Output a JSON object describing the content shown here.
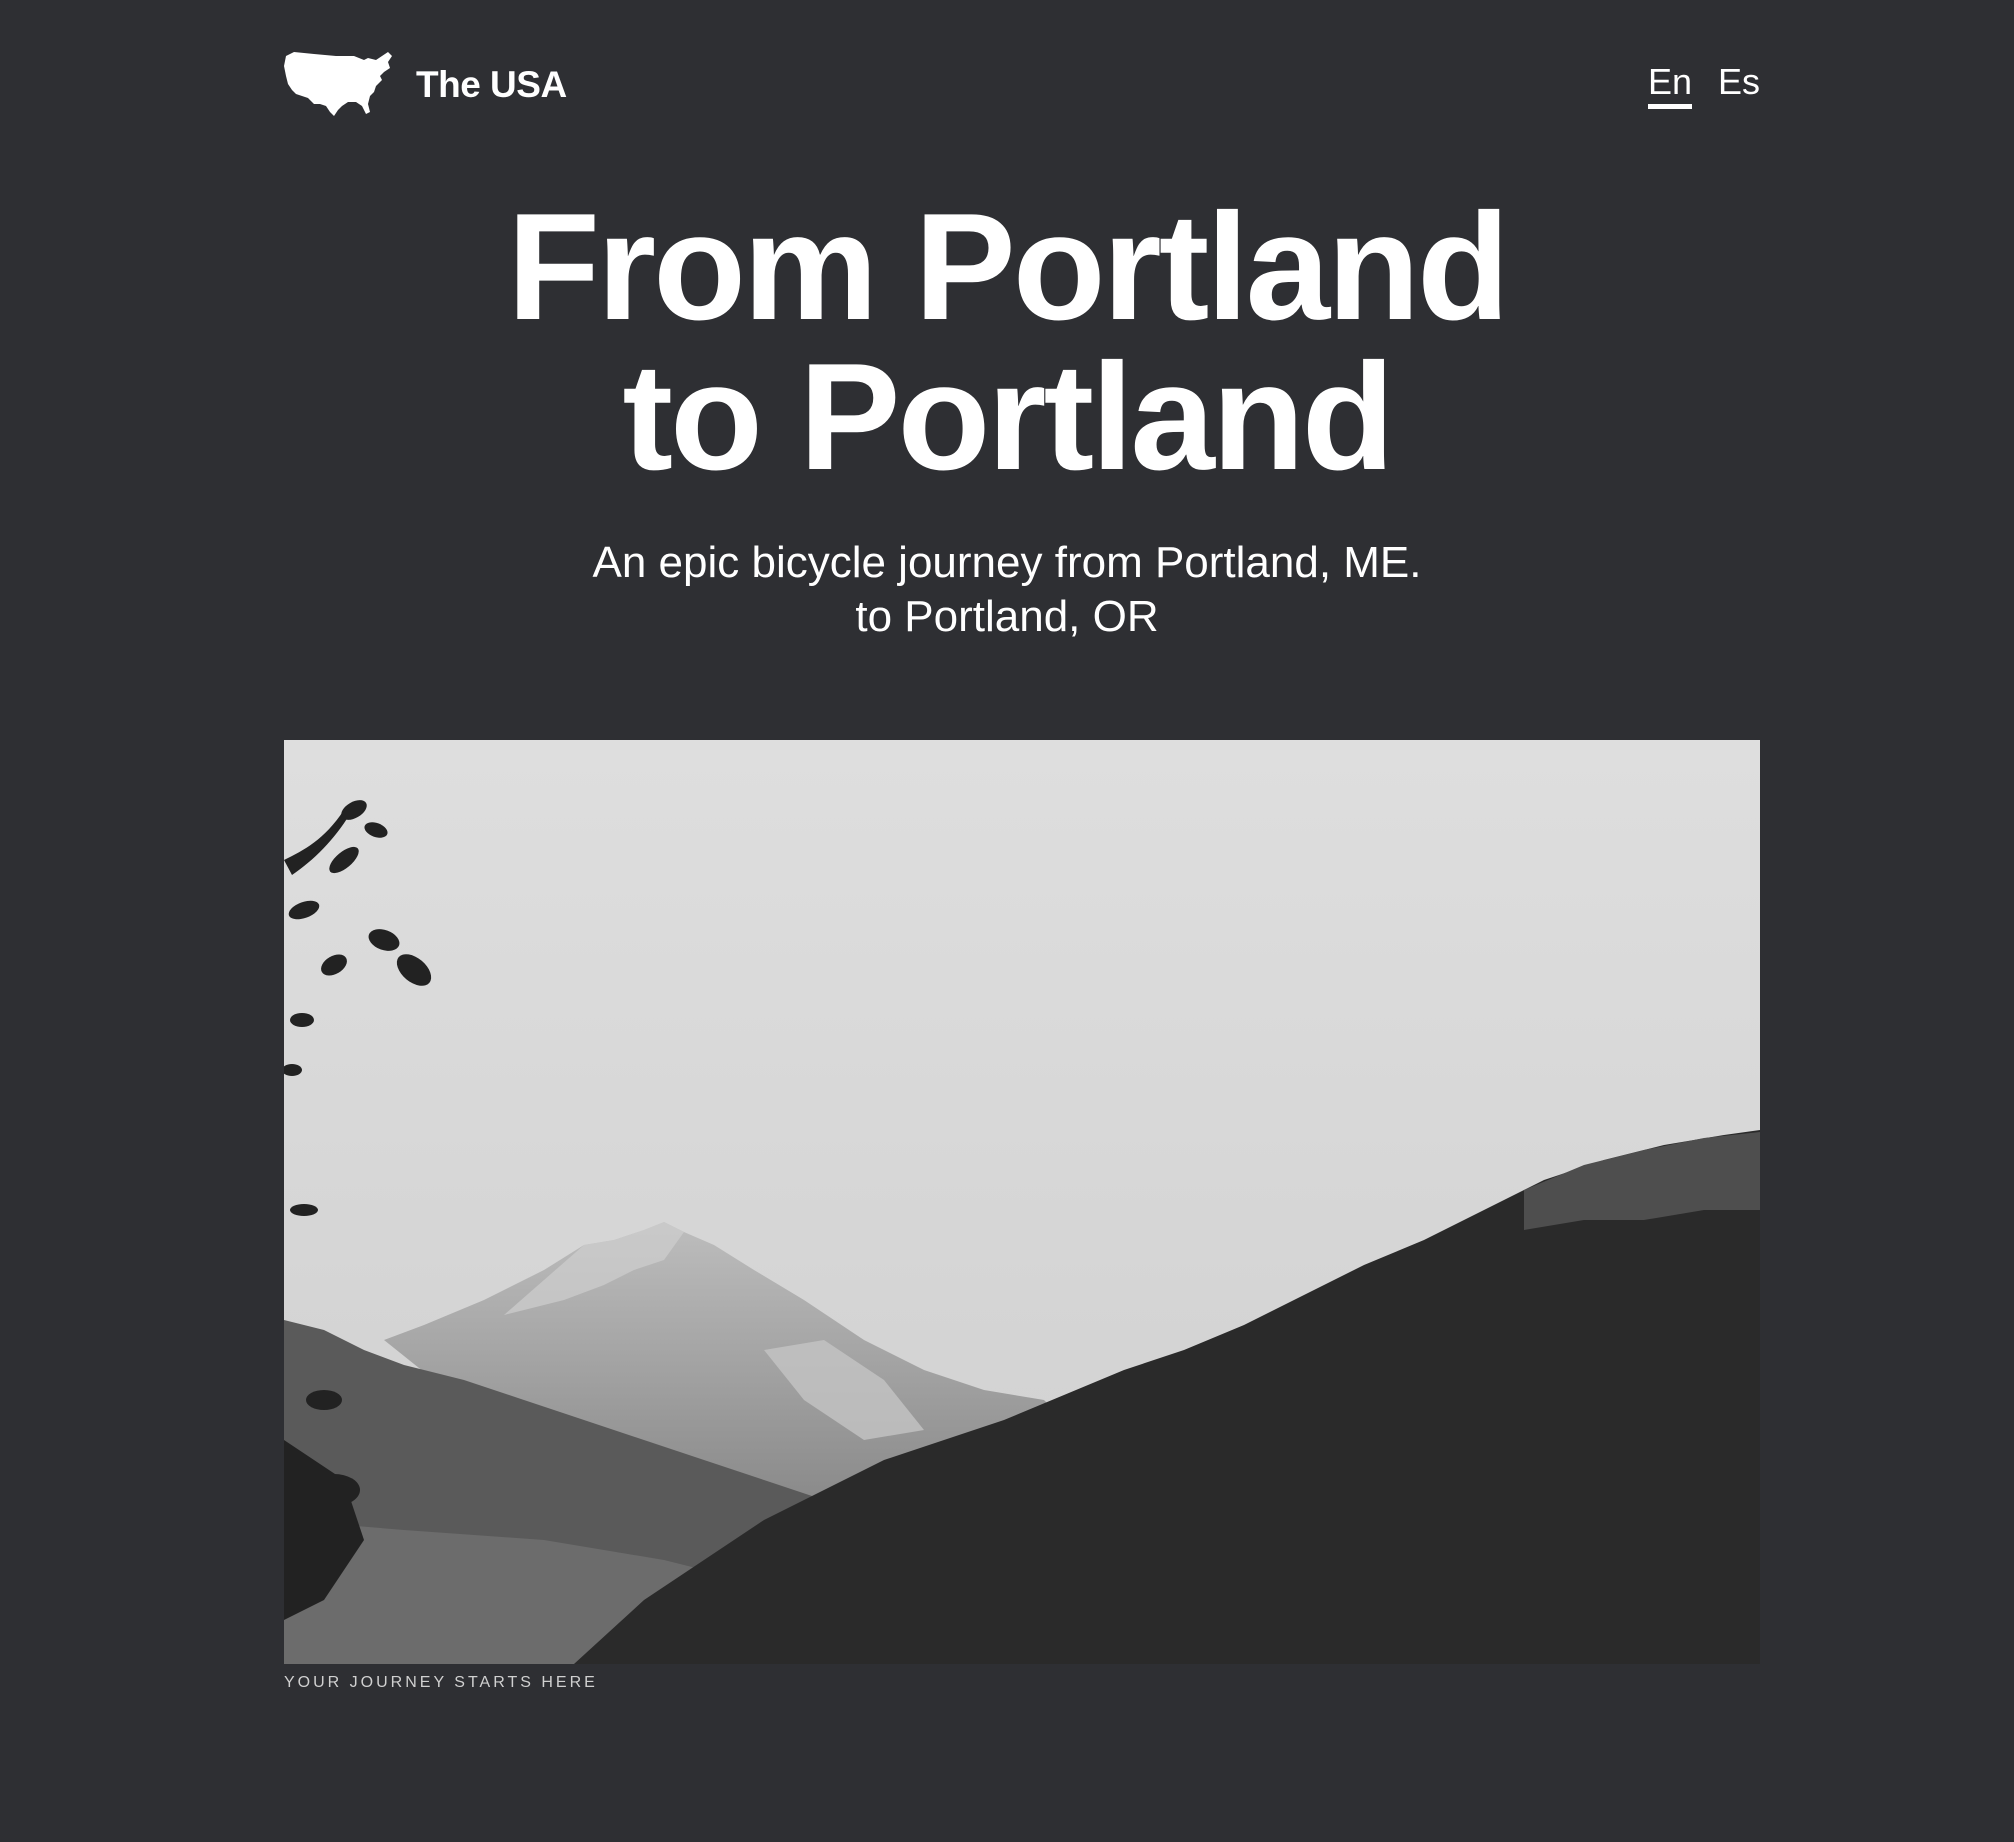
{
  "header": {
    "logo_text": "The USA",
    "logo_icon": "usa-map-icon",
    "languages": [
      {
        "label": "En",
        "active": true
      },
      {
        "label": "Es",
        "active": false
      }
    ]
  },
  "hero": {
    "title_line1": "From Portland",
    "title_line2": "to Portland",
    "subtitle_line1": "An epic bicycle journey from Portland, ME.",
    "subtitle_line2": "to Portland, OR"
  },
  "photo": {
    "description_icon": "mountain-landscape-image",
    "caption": "YOUR JOURNEY STARTS HERE"
  },
  "colors": {
    "background": "#2e2f33",
    "text": "#ffffff"
  }
}
